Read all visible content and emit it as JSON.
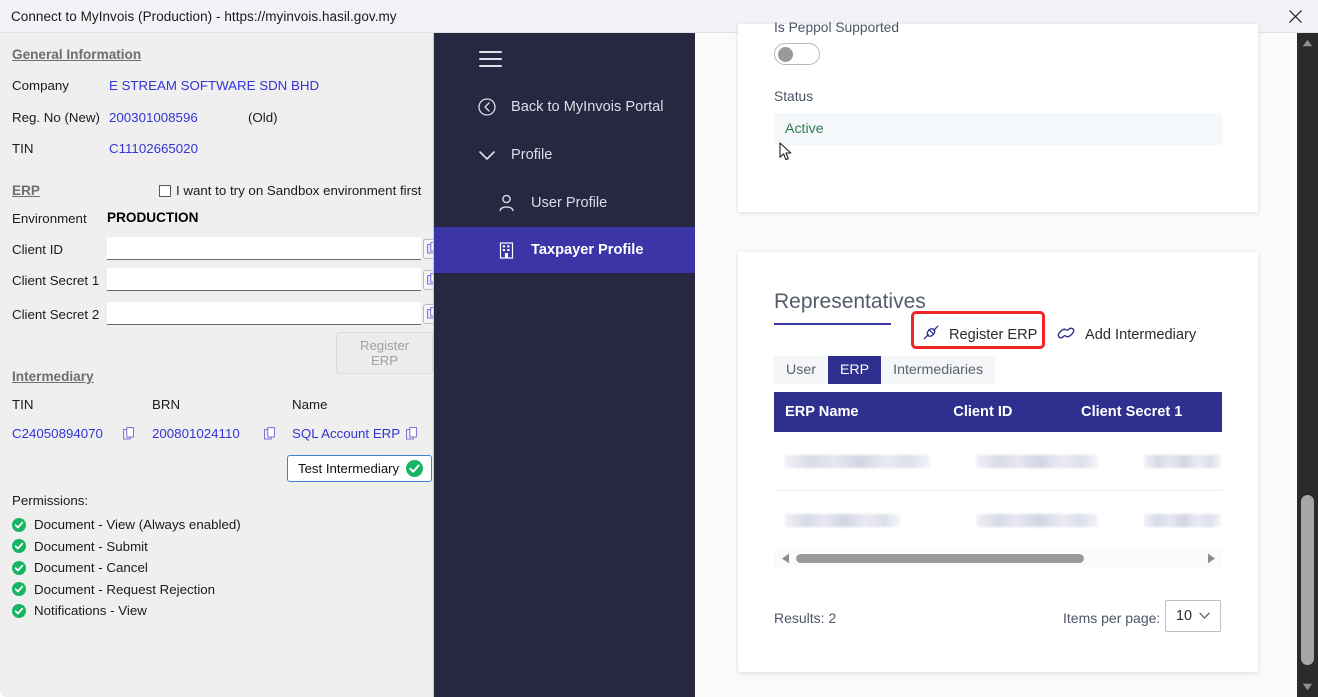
{
  "window": {
    "title": "Connect to MyInvois (Production) - https://myinvois.hasil.gov.my",
    "close_icon": "close-icon"
  },
  "erp_panel": {
    "general_information": {
      "heading": "General Information",
      "fields": [
        {
          "label": "Company",
          "value": "E STREAM SOFTWARE SDN BHD"
        },
        {
          "label": "Reg. No (New)",
          "value": "200301008596",
          "suffix": "(Old)"
        },
        {
          "label": "TIN",
          "value": "C11102665020"
        }
      ]
    },
    "erp": {
      "heading": "ERP",
      "sandbox_checkbox_label": "I want to try on Sandbox environment first",
      "sandbox_checked": false,
      "environment_label": "Environment",
      "environment_value": "PRODUCTION",
      "inputs": [
        {
          "label": "Client ID",
          "value": "",
          "placeholder": ""
        },
        {
          "label": "Client Secret 1",
          "value": "",
          "placeholder": ""
        },
        {
          "label": "Client Secret 2",
          "value": "",
          "placeholder": ""
        }
      ],
      "register_button": "Register ERP",
      "register_button_enabled": false
    },
    "intermediary": {
      "heading": "Intermediary",
      "columns": [
        "TIN",
        "BRN",
        "Name"
      ],
      "row": {
        "tin": "C24050894070",
        "brn": "200801024110",
        "name": "SQL Account ERP"
      },
      "test_button": "Test Intermediary",
      "test_status_icon": "check-circle-icon"
    },
    "permissions": {
      "heading": "Permissions:",
      "items": [
        "Document - View (Always enabled)",
        "Document - Submit",
        "Document - Cancel",
        "Document - Request Rejection",
        "Notifications - View"
      ]
    }
  },
  "sidebar": {
    "menu_icon": "hamburger-icon",
    "items": [
      {
        "label": "Back to MyInvois Portal",
        "icon": "back-circle-icon",
        "active": false
      },
      {
        "label": "Profile",
        "icon": "chevron-down-icon",
        "active": false
      },
      {
        "label": "User Profile",
        "icon": "user-icon",
        "active": false
      },
      {
        "label": "Taxpayer Profile",
        "icon": "building-icon",
        "active": true
      }
    ]
  },
  "main": {
    "top_card": {
      "peppol_label": "Is Peppol Supported",
      "peppol_enabled": false,
      "status_label": "Status",
      "status_value": "Active"
    },
    "representatives": {
      "title": "Representatives",
      "actions": [
        {
          "label": "Register ERP",
          "icon": "plug-icon",
          "highlighted": true
        },
        {
          "label": "Add Intermediary",
          "icon": "link-icon",
          "highlighted": false
        }
      ],
      "tabs": [
        {
          "label": "User",
          "active": false
        },
        {
          "label": "ERP",
          "active": true
        },
        {
          "label": "Intermediaries",
          "active": false
        }
      ],
      "table": {
        "columns": [
          "ERP Name",
          "Client ID",
          "Client Secret 1"
        ],
        "rows": [
          {
            "erp_name": "",
            "client_id": "",
            "client_secret": "",
            "redacted": true
          },
          {
            "erp_name": "",
            "client_id": "",
            "client_secret": "",
            "redacted": true
          }
        ]
      },
      "results_label": "Results: 2",
      "items_per_page_label": "Items per page:",
      "items_per_page_value": "10"
    }
  },
  "colors": {
    "accent_navy": "#2f2f8f",
    "sidebar_bg": "#272742",
    "active_nav": "#3b35a8",
    "link_blue": "#3434d6",
    "status_green": "#2d7d4f",
    "highlight_red": "#ef2626"
  }
}
